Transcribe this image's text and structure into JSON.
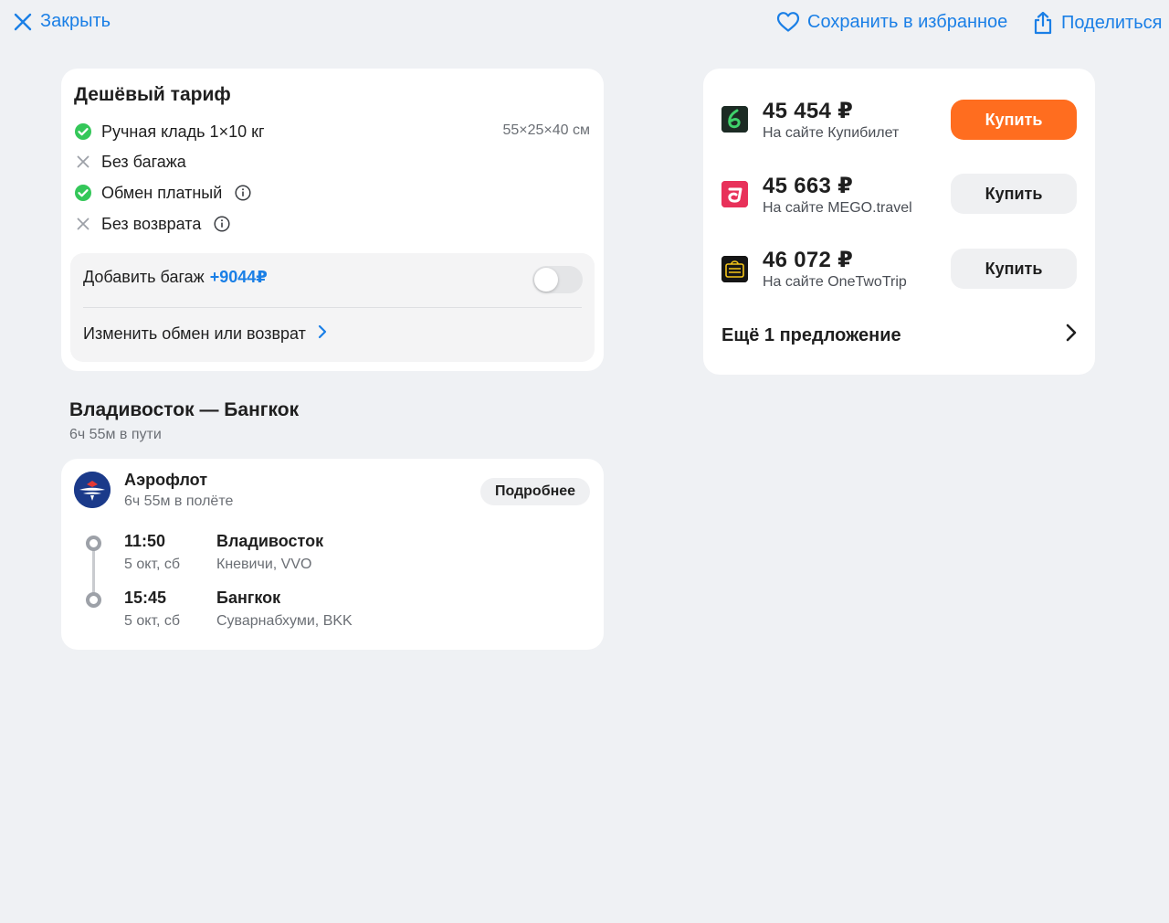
{
  "topbar": {
    "close_label": "Закрыть",
    "favorite_label": "Сохранить в избранное",
    "share_label": "Поделиться"
  },
  "tariff": {
    "title": "Дешёвый тариф",
    "features": [
      {
        "label": "Ручная кладь 1×10 кг",
        "included": true,
        "icon": "check-circle-icon"
      },
      {
        "label": "Без багажа",
        "included": false,
        "icon": "cross-icon"
      },
      {
        "label": "Обмен платный",
        "included": true,
        "icon": "check-circle-icon"
      },
      {
        "label": "Без возврата",
        "included": false,
        "icon": "cross-icon"
      }
    ],
    "hand_luggage_size": "55×25×40 см",
    "add_baggage_label": "Добавить багаж",
    "add_baggage_price": "+9044₽",
    "add_baggage_enabled": false,
    "change_label": "Изменить обмен или возврат"
  },
  "route": {
    "title": "Владивосток — Бангкок",
    "duration": "6ч 55м в пути"
  },
  "flight": {
    "airline": "Аэрофлот",
    "flight_duration": "6ч 55м в полёте",
    "details_label": "Подробнее",
    "departure": {
      "time": "11:50",
      "date": "5 окт, сб",
      "city": "Владивосток",
      "airport": "Кневичи, VVO"
    },
    "arrival": {
      "time": "15:45",
      "date": "5 окт, сб",
      "city": "Бангкок",
      "airport": "Суварнабхуми, BKK"
    }
  },
  "offers": {
    "items": [
      {
        "price": "45 454 ₽",
        "site": "На сайте Купибилет",
        "buy_label": "Купить",
        "primary": true,
        "logo": "kupibilet-logo"
      },
      {
        "price": "45 663 ₽",
        "site": "На сайте MEGO.travel",
        "buy_label": "Купить",
        "primary": false,
        "logo": "mego-logo"
      },
      {
        "price": "46 072 ₽",
        "site": "На сайте OneTwoTrip",
        "buy_label": "Купить",
        "primary": false,
        "logo": "onetwotrip-logo"
      }
    ],
    "more_label": "Ещё 1 предложение"
  },
  "colors": {
    "accent": "#1a7fe6",
    "buy_primary": "#ff6d1f",
    "check_green": "#34c759",
    "background": "#eff1f4"
  }
}
